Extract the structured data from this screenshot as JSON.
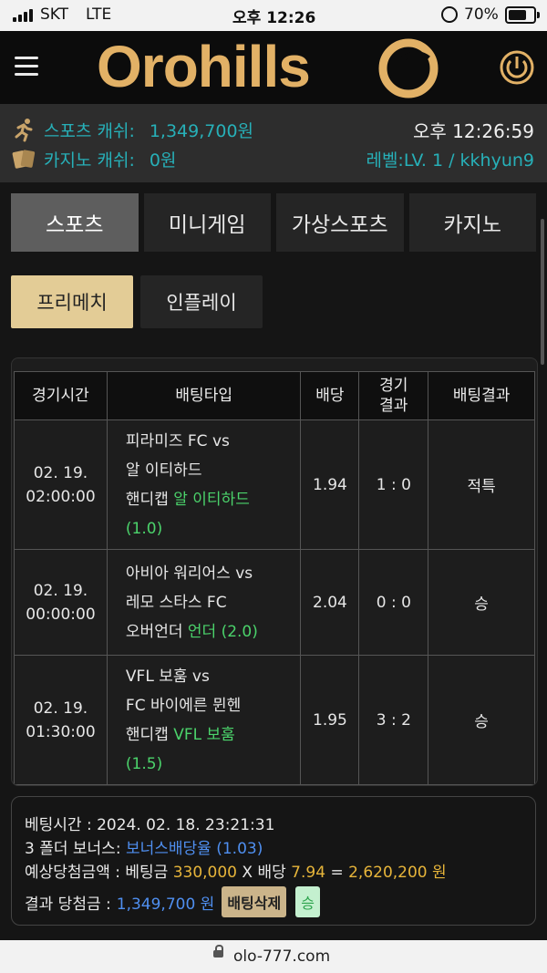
{
  "status_bar": {
    "carrier": "SKT",
    "network": "LTE",
    "time": "오후 12:26",
    "battery": "70%"
  },
  "header": {
    "logo": "Orohills"
  },
  "user": {
    "sports_cash_label": "스포츠 캐쉬:",
    "sports_cash_value": "1,349,700원",
    "casino_cash_label": "카지노 캐쉬:",
    "casino_cash_value": "0원",
    "clock": "오후 12:26:59",
    "level": "레벨:LV. 1 / kkhyun9"
  },
  "tabs": [
    "스포츠",
    "미니게임",
    "가상스포츠",
    "카지노"
  ],
  "subtabs": [
    "프리메치",
    "인플레이"
  ],
  "table": {
    "headers": {
      "time": "경기시간",
      "type": "배팅타입",
      "odds": "배당",
      "result_l1": "경기",
      "result_l2": "결과",
      "bet_result": "배팅결과"
    },
    "rows": [
      {
        "date": "02. 19.",
        "time": "02:00:00",
        "match1": "피라미즈 FC vs",
        "match2": "알 이티하드",
        "bet_type": "핸디캡",
        "pick": "알 이티하드",
        "line": "(1.0)",
        "odds": "1.94",
        "score": "1 : 0",
        "result": "적특"
      },
      {
        "date": "02. 19.",
        "time": "00:00:00",
        "match1": "아비아 워리어스 vs",
        "match2": "레모 스타스 FC",
        "bet_type": "오버언더",
        "pick": "언더",
        "line": "(2.0)",
        "odds": "2.04",
        "score": "0 : 0",
        "result": "승"
      },
      {
        "date": "02. 19.",
        "time": "01:30:00",
        "match1": "VFL 보훔 vs",
        "match2": "FC 바이에른 뮌헨",
        "bet_type": "핸디캡",
        "pick": "VFL 보훔",
        "line": "(1.5)",
        "odds": "1.95",
        "score": "3 : 2",
        "result": "승"
      }
    ]
  },
  "summary": {
    "bet_time_label": "베팅시간 :",
    "bet_time": "2024. 02. 18. 23:21:31",
    "bonus_label": "3 폴더 보너스:",
    "bonus_value": "보너스배당율 (1.03)",
    "expected_label": "예상당첨금액 : 베팅금",
    "stake": "330,000",
    "x_label": "X 배당",
    "total_odds": "7.94",
    "eq": "=",
    "payout": "2,620,200 원",
    "result_label": "결과 당첨금 :",
    "result_value": "1,349,700 원",
    "delete_button": "배팅삭제",
    "win_badge": "승"
  },
  "url_bar": {
    "url": "olo-777.com"
  },
  "colors": {
    "brand_gold": "#e2b166",
    "accent_teal": "#27b0b8",
    "odds_yellow": "#e7b53a",
    "win_blue": "#4f8ff0",
    "pick_green": "#4bd36b",
    "refund_red": "#e54848"
  }
}
